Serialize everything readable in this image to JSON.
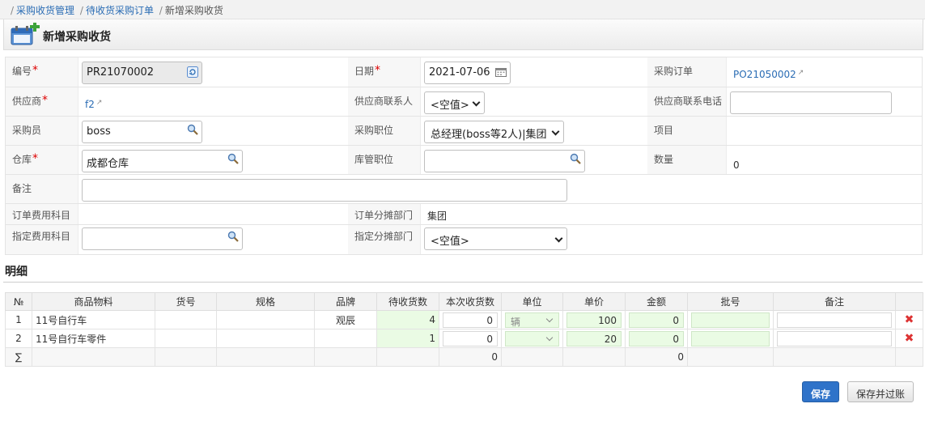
{
  "breadcrumb": {
    "items": [
      "采购收货管理",
      "待收货采购订单",
      "新增采购收货"
    ]
  },
  "page": {
    "title": "新增采购收货"
  },
  "form": {
    "code_label": "编号",
    "code_value": "PR21070002",
    "date_label": "日期",
    "date_value": "2021-07-06",
    "po_label": "采购订单",
    "po_value": "PO21050002",
    "supplier_label": "供应商",
    "supplier_value": "f2",
    "supplier_contact_label": "供应商联系人",
    "supplier_contact_value": "<空值>",
    "supplier_phone_label": "供应商联系电话",
    "supplier_phone_value": "",
    "buyer_label": "采购员",
    "buyer_value": "boss",
    "buyer_position_label": "采购职位",
    "buyer_position_value": "总经理(boss等2人)|集团",
    "project_label": "项目",
    "project_value": "",
    "warehouse_label": "仓库",
    "warehouse_value": "成都仓库",
    "keeper_position_label": "库管职位",
    "keeper_position_value": "",
    "quantity_label": "数量",
    "quantity_value": "0",
    "remark_label": "备注",
    "remark_value": "",
    "order_fee_label": "订单费用科目",
    "order_fee_value": "",
    "order_dept_label": "订单分摊部门",
    "order_dept_value": "集团",
    "assign_fee_label": "指定费用科目",
    "assign_fee_value": "",
    "assign_dept_label": "指定分摊部门",
    "assign_dept_value": "<空值>"
  },
  "detail": {
    "section_title": "明细",
    "columns": [
      "№",
      "商品物料",
      "货号",
      "规格",
      "品牌",
      "待收货数",
      "本次收货数",
      "单位",
      "单价",
      "金额",
      "批号",
      "备注",
      ""
    ],
    "rows": [
      {
        "no": "1",
        "item": "11号自行车",
        "sku": "",
        "spec": "",
        "brand": "观辰",
        "pending": "4",
        "receive": "0",
        "unit": "辆",
        "price": "100",
        "amount": "0",
        "batch": "",
        "remark": ""
      },
      {
        "no": "2",
        "item": "11号自行车零件",
        "sku": "",
        "spec": "",
        "brand": "",
        "pending": "1",
        "receive": "0",
        "unit": "",
        "price": "20",
        "amount": "0",
        "batch": "",
        "remark": ""
      }
    ],
    "sum": {
      "symbol": "∑",
      "receive_total": "0",
      "amount_total": "0"
    }
  },
  "buttons": {
    "save": "保存",
    "save_post": "保存并过账"
  },
  "icons": {
    "page": "calendar-add-icon",
    "refresh": "refresh-icon",
    "calendar": "calendar-icon",
    "search": "search-icon",
    "external": "external-link-icon",
    "delete": "delete-x-icon"
  },
  "colors": {
    "accent": "#2f73c9",
    "link": "#2a6cb4",
    "required": "#dd0000",
    "editable_cell": "#eafbe4",
    "delete": "#dd3333"
  }
}
